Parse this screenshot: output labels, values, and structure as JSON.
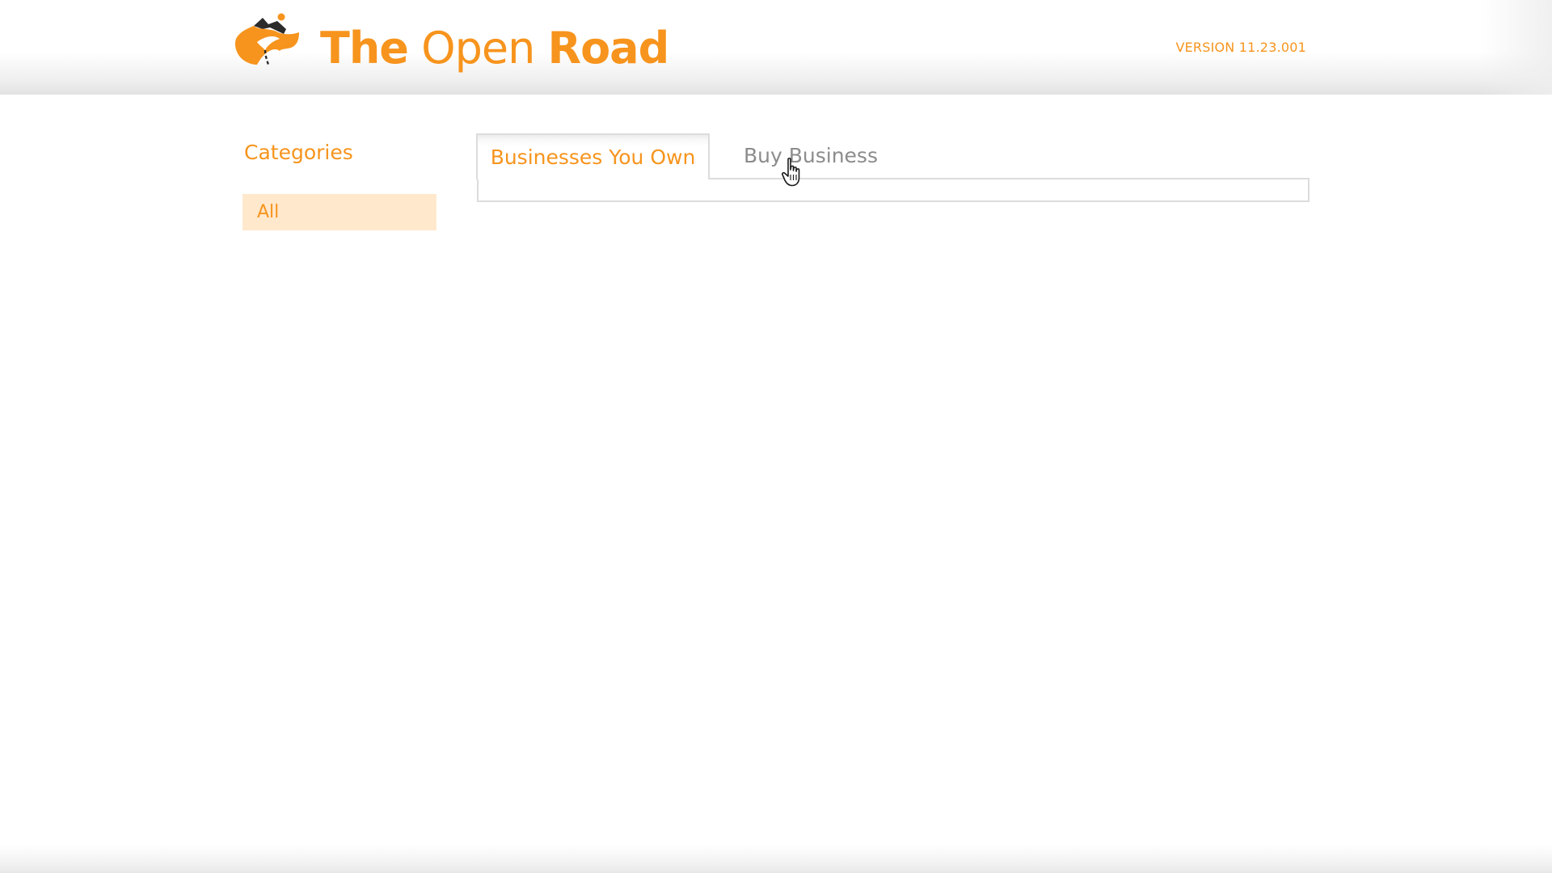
{
  "header": {
    "brand": {
      "word1": "The",
      "word2": "Open",
      "word3": "Road"
    },
    "version": "VERSION 11.23.001",
    "logo_icon": "road-mountain-logo"
  },
  "sidebar": {
    "title": "Categories",
    "items": [
      {
        "label": "All",
        "selected": true
      }
    ]
  },
  "main": {
    "tabs": [
      {
        "label": "Businesses You Own",
        "active": true
      },
      {
        "label": "Buy Business",
        "active": false
      }
    ]
  },
  "cursor": {
    "icon": "hand-pointer-icon"
  },
  "colors": {
    "accent": "#f7941d",
    "selected_bg": "#ffe8cc",
    "inactive_text": "#8c8c8c",
    "border": "#dcdcdc"
  }
}
